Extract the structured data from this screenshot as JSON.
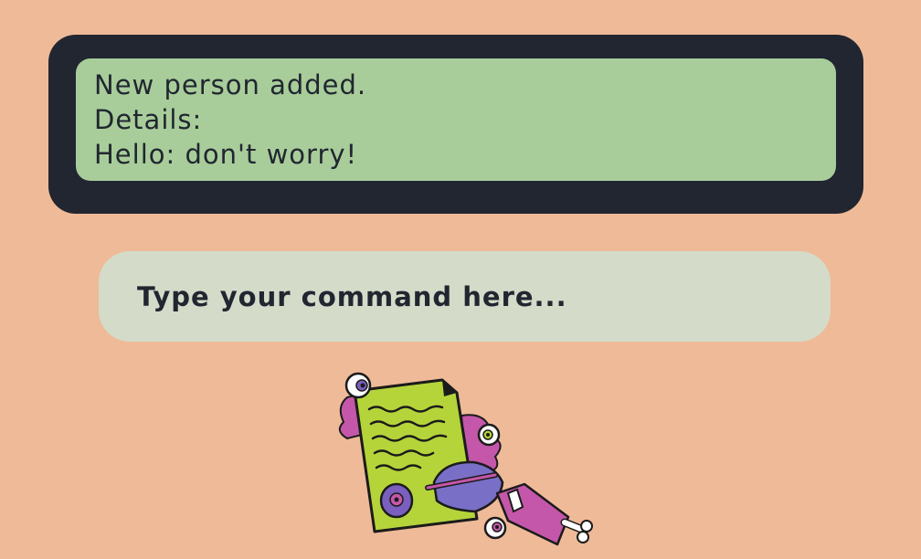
{
  "result": {
    "lines": [
      "New person added.",
      "Details:",
      "Hello: don't worry!"
    ]
  },
  "command": {
    "placeholder": "Type your command here...",
    "value": ""
  },
  "illustration": {
    "icon": "monster-writing-note-illustration"
  },
  "colors": {
    "background": "#efba98",
    "result_frame": "#212630",
    "result_box": "#a8cd9a",
    "command_box": "#d4dbc9",
    "text": "#212630"
  }
}
